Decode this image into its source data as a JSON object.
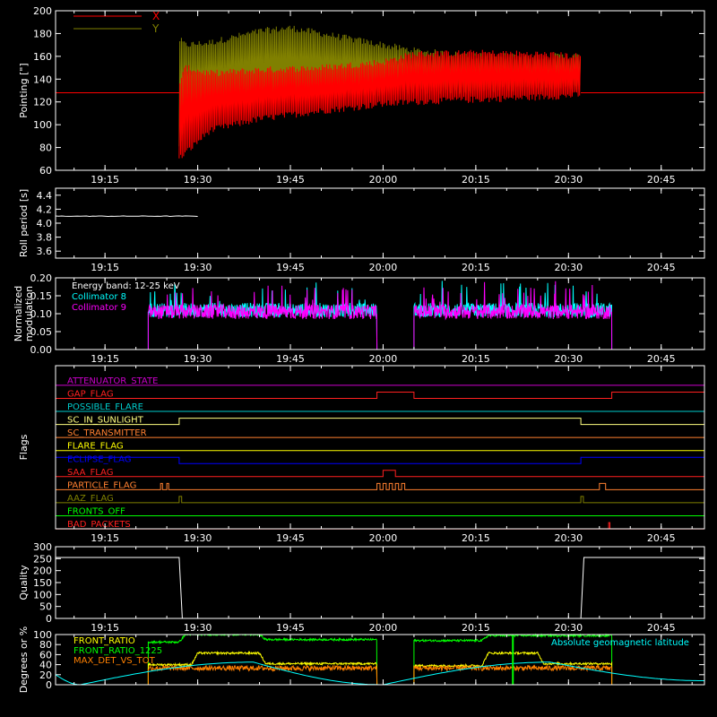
{
  "figure": {
    "time_ticks": [
      "19:15",
      "19:30",
      "19:45",
      "20:00",
      "20:15",
      "20:30",
      "20:45"
    ],
    "time_range": [
      "19:07",
      "20:52"
    ]
  },
  "chart_data": [
    {
      "type": "line",
      "panel": "pointing",
      "ylabel": "Pointing [\"]",
      "ylim": [
        60,
        200
      ],
      "yticks": [
        "60",
        "80",
        "100",
        "120",
        "140",
        "160",
        "180",
        "200"
      ],
      "legend": [
        "X",
        "Y"
      ],
      "colors": {
        "X": "#ff0000",
        "Y": "#808000"
      },
      "series": [
        {
          "name": "X",
          "baseline": 128,
          "active": [
            "19:27",
            "20:32"
          ],
          "x": [
            "19:27",
            "19:28",
            "19:32",
            "19:40",
            "19:50",
            "20:00",
            "20:05",
            "20:15",
            "20:25",
            "20:32"
          ],
          "upper": [
            135,
            150,
            145,
            148,
            150,
            155,
            162,
            163,
            162,
            160
          ],
          "lower": [
            70,
            75,
            95,
            105,
            112,
            118,
            120,
            122,
            124,
            126
          ]
        },
        {
          "name": "Y",
          "baseline": 128,
          "active": [
            "19:27",
            "20:32"
          ],
          "x": [
            "19:27",
            "19:28",
            "19:32",
            "19:40",
            "19:45",
            "19:50",
            "20:00",
            "20:05",
            "20:15",
            "20:25",
            "20:32"
          ],
          "upper": [
            175,
            170,
            172,
            182,
            185,
            180,
            170,
            165,
            160,
            160,
            160
          ],
          "lower": [
            80,
            100,
            115,
            120,
            122,
            125,
            128,
            130,
            130,
            132,
            133
          ]
        }
      ]
    },
    {
      "type": "line",
      "panel": "roll",
      "ylabel": "Roll period [s]",
      "ylim": [
        3.5,
        4.5
      ],
      "yticks": [
        "3.6",
        "3.8",
        "4.0",
        "4.2",
        "4.4"
      ],
      "series": [
        {
          "x": [
            "19:07",
            "19:30"
          ],
          "y": [
            4.1,
            4.1
          ]
        }
      ]
    },
    {
      "type": "line",
      "panel": "modulation",
      "ylabel": [
        "Normalized",
        "modulation"
      ],
      "ylim": [
        0,
        0.2
      ],
      "yticks": [
        "0.00",
        "0.05",
        "0.10",
        "0.15",
        "0.20"
      ],
      "annotations": [
        "Energy band: 12-25 keV"
      ],
      "legend": [
        "Collimator 8",
        "Collimator 9"
      ],
      "colors": {
        "Collimator 8": "#00ffff",
        "Collimator 9": "#ff00ff"
      },
      "series": [
        {
          "name": "Collimator 8",
          "segments": [
            [
              "19:22",
              "19:59"
            ],
            [
              "20:05",
              "20:37"
            ]
          ],
          "mean": 0.11
        },
        {
          "name": "Collimator 9",
          "segments": [
            [
              "19:22",
              "19:59"
            ],
            [
              "20:05",
              "20:37"
            ]
          ],
          "mean": 0.105
        }
      ]
    },
    {
      "type": "line",
      "panel": "flags",
      "ylabel": "Flags",
      "series": [
        {
          "name": "ATTENUATOR_STATE",
          "color": "#cc00cc",
          "high": []
        },
        {
          "name": "GAP_FLAG",
          "color": "#ff2020",
          "high": [
            [
              "19:59",
              "20:05"
            ],
            [
              "20:37",
              "20:52"
            ]
          ]
        },
        {
          "name": "POSSIBLE_FLARE",
          "color": "#00cccc",
          "high": []
        },
        {
          "name": "SC_IN_SUNLIGHT",
          "color": "#ffff80",
          "high": [
            [
              "19:27",
              "20:32"
            ]
          ]
        },
        {
          "name": "SC_TRANSMITTER",
          "color": "#ff8030",
          "high": []
        },
        {
          "name": "FLARE_FLAG",
          "color": "#ffff00",
          "high": []
        },
        {
          "name": "ECLIPSE_FLAG",
          "color": "#0000ff",
          "high": [
            [
              "19:07",
              "19:27"
            ],
            [
              "20:32",
              "20:52"
            ]
          ]
        },
        {
          "name": "SAA_FLAG",
          "color": "#ff2020",
          "high": [
            [
              "20:00",
              "20:02"
            ]
          ]
        },
        {
          "name": "PARTICLE_FLAG",
          "color": "#ff8030",
          "high": [
            [
              "19:24",
              "19:24.3"
            ],
            [
              "19:25",
              "19:25.3"
            ],
            [
              "19:59",
              "19:59.5"
            ],
            [
              "20:00",
              "20:00.5"
            ],
            [
              "20:01",
              "20:01.5"
            ],
            [
              "20:02",
              "20:02.5"
            ],
            [
              "20:03",
              "20:03.5"
            ],
            [
              "20:35",
              "20:36"
            ]
          ]
        },
        {
          "name": "AAZ_FLAG",
          "color": "#808000",
          "high": [
            [
              "19:27",
              "19:27.4"
            ],
            [
              "20:32",
              "20:32.4"
            ]
          ]
        },
        {
          "name": "FRONTS_OFF",
          "color": "#00ff00",
          "high": []
        },
        {
          "name": "BAD_PACKETS",
          "color": "#ff2020",
          "high": [
            [
              "20:36.5",
              "20:36.7"
            ]
          ]
        }
      ]
    },
    {
      "type": "line",
      "panel": "quality",
      "ylabel": "Quality",
      "ylim": [
        0,
        300
      ],
      "yticks": [
        "0",
        "50",
        "100",
        "150",
        "200",
        "250",
        "300"
      ],
      "series": [
        {
          "x": [
            "19:07",
            "19:27",
            "19:27.5",
            "20:32",
            "20:32.5",
            "20:52"
          ],
          "y": [
            255,
            255,
            0,
            0,
            255,
            255
          ]
        }
      ]
    },
    {
      "type": "line",
      "panel": "ratios",
      "ylabel": "Degrees or %",
      "ylim": [
        0,
        100
      ],
      "yticks": [
        "0",
        "20",
        "40",
        "60",
        "80",
        "100"
      ],
      "legend": [
        "FRONT_RATIO",
        "FRONT_RATIO_1225",
        "MAX_DET_VS_TOT",
        "Absolute geomagnetic latitude"
      ],
      "colors": {
        "FRONT_RATIO": "#ffff00",
        "FRONT_RATIO_1225": "#00ff00",
        "MAX_DET_VS_TOT": "#ff8000",
        "Absolute geomagnetic latitude": "#00ffff"
      },
      "series": [
        {
          "name": "FRONT_RATIO_1225",
          "segments": [
            [
              "19:22",
              "19:59"
            ],
            [
              "20:05",
              "20:37"
            ]
          ],
          "x": [
            "19:22",
            "19:27",
            "19:28",
            "19:40",
            "19:41",
            "19:59",
            "20:05",
            "20:16",
            "20:17",
            "20:37"
          ],
          "y": [
            85,
            85,
            100,
            100,
            90,
            90,
            88,
            88,
            98,
            98
          ]
        },
        {
          "name": "FRONT_RATIO",
          "segments": [
            [
              "19:22",
              "19:59"
            ],
            [
              "20:05",
              "20:37"
            ]
          ],
          "x": [
            "19:22",
            "19:29",
            "19:30",
            "19:40",
            "19:41",
            "19:59",
            "20:05",
            "20:16",
            "20:17",
            "20:25",
            "20:26",
            "20:37"
          ],
          "y": [
            40,
            40,
            63,
            63,
            42,
            42,
            38,
            38,
            63,
            63,
            42,
            42
          ]
        },
        {
          "name": "MAX_DET_VS_TOT",
          "segments": [
            [
              "19:22",
              "19:59"
            ],
            [
              "20:05",
              "20:37"
            ]
          ],
          "mean": 33
        },
        {
          "name": "Absolute geomagnetic latitude",
          "x": [
            "19:07",
            "19:11",
            "19:39",
            "20:00",
            "20:27",
            "20:52"
          ],
          "y": [
            20,
            0,
            45,
            0,
            45,
            8
          ]
        }
      ]
    }
  ]
}
